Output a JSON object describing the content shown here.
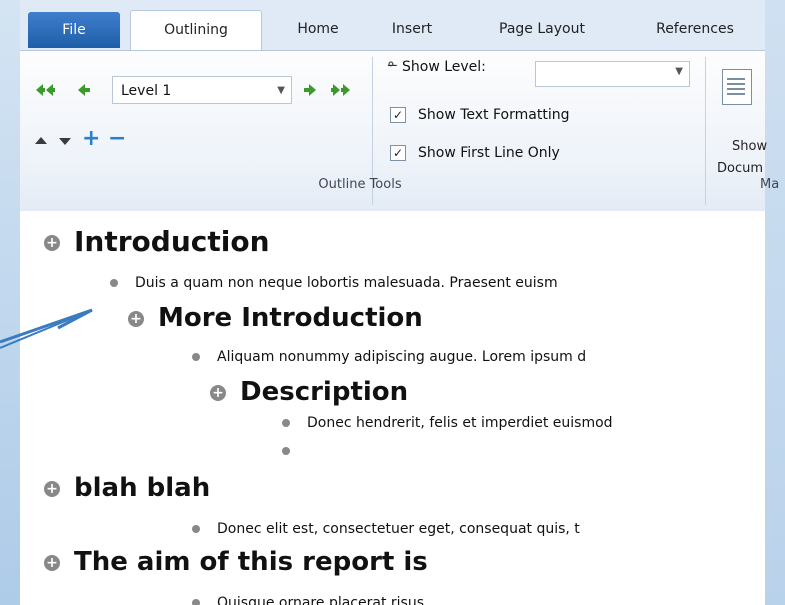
{
  "tabs": {
    "file": "File",
    "outlining": "Outlining",
    "home": "Home",
    "insert": "Insert",
    "page_layout": "Page Layout",
    "references": "References"
  },
  "outline_tools": {
    "level_value": "Level 1",
    "show_level_label": "Show Level:",
    "show_level_value": "",
    "show_text_formatting": "Show Text Formatting",
    "show_text_formatting_checked": true,
    "show_first_line_only": "Show First Line Only",
    "show_first_line_only_checked": true,
    "group_label": "Outline Tools"
  },
  "master_doc": {
    "show_doc_line1": "Show",
    "show_doc_line2": "Docum",
    "group_label": "Ma"
  },
  "document": {
    "lines": [
      {
        "type": "heading",
        "text": "Introduction"
      },
      {
        "type": "body",
        "text": "Duis a quam non neque lobortis malesuada. Praesent euism"
      },
      {
        "type": "heading",
        "text": "More Introduction"
      },
      {
        "type": "body",
        "text": "Aliquam nonummy adipiscing augue. Lorem ipsum d"
      },
      {
        "type": "heading",
        "text": "Description"
      },
      {
        "type": "body",
        "text": "Donec hendrerit, felis et imperdiet euismod"
      },
      {
        "type": "body",
        "text": ""
      },
      {
        "type": "heading",
        "text": "blah blah"
      },
      {
        "type": "body",
        "text": "Donec elit est, consectetuer eget, consequat quis, t"
      },
      {
        "type": "heading",
        "text": "The aim of this report is"
      },
      {
        "type": "body",
        "text": "Quisque ornare placerat risus"
      }
    ]
  },
  "colors": {
    "file_tab": "#2a6bb8",
    "accent_green": "#3a9a2a",
    "accent_blue": "#2a7fd0",
    "callout_arrow": "#3b7bbf"
  }
}
